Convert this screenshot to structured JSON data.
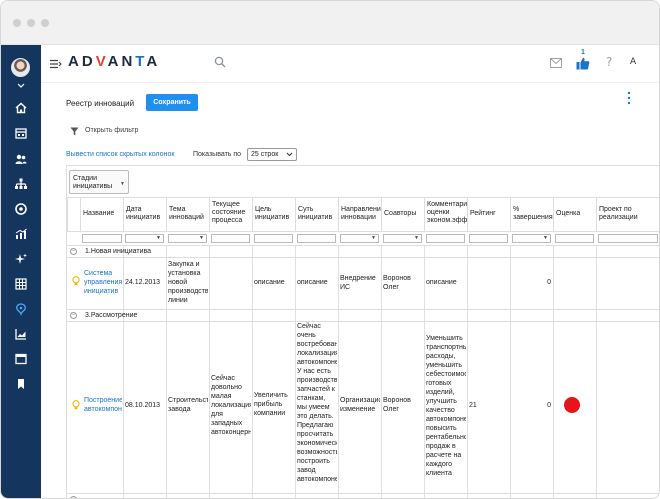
{
  "app": {
    "logo_text": "ADVANTA",
    "like_count": "1",
    "help_glyph": "?",
    "lang_glyph": "A",
    "colors": {
      "sidebar": "#14365e",
      "accent": "#1f8ff0",
      "link": "#1a73c8",
      "danger": "#e8141a"
    }
  },
  "toolbar": {
    "page_title": "Реестр инноваций",
    "save_label": "Сохранить",
    "filter_label": "Открыть фильтр",
    "hidden_columns_link": "Вывести список скрытых колонок",
    "show_by_label": "Показывать по",
    "show_by_value": "25 строк"
  },
  "grid": {
    "groupby_label": "Стадии инициативы",
    "columns": [
      {
        "key": "name",
        "label": "Название"
      },
      {
        "key": "date",
        "label": "Дата инициатив"
      },
      {
        "key": "topic",
        "label": "Тема инноваций"
      },
      {
        "key": "state",
        "label": "Текущее состояние процесса"
      },
      {
        "key": "goal",
        "label": "Цель инициатив"
      },
      {
        "key": "essence",
        "label": "Суть инициатив"
      },
      {
        "key": "direction",
        "label": "Направлени инновации"
      },
      {
        "key": "coauthors",
        "label": "Соавторы"
      },
      {
        "key": "comment",
        "label": "Комментарий оценки эконом.эфф"
      },
      {
        "key": "rating",
        "label": "Рейтинг"
      },
      {
        "key": "completion",
        "label": "% завершения"
      },
      {
        "key": "score",
        "label": "Оценка"
      },
      {
        "key": "project",
        "label": "Проект по реализации"
      }
    ],
    "groups": [
      {
        "label": "1.Новая инициатива",
        "rows": [
          {
            "name": "Система управления инициатив",
            "date": "24.12.2013",
            "topic": "Закупка и установка новой производственной линии",
            "state": "",
            "goal": "описание",
            "essence": "описание",
            "direction": "Внедрение ИС",
            "coauthors": "Воронов Олег",
            "comment": "описание",
            "rating": "",
            "completion": "0",
            "score": "",
            "project": ""
          }
        ]
      },
      {
        "label": "3.Рассмотрение",
        "rows": [
          {
            "name": "Построение автокомпонентов",
            "date": "08.10.2013",
            "topic": "Строительство завода",
            "state": "Сейчас довольно малая локализация для западных автоконцернов",
            "goal": "Увеличить прибыль компании",
            "essence": "Сейчас очень востребована локализация автокомпонентов. У нас есть производство запчастей к станкам, мы умеем это делать. Предлагаю просчитать экономическую возможность построить завод автокомпонентов",
            "direction": "Организационное изменение",
            "coauthors": "Воронов Олег",
            "comment": "Уменьшить транспортные расходы, уменьшить себестоимость готовых изделий, улучшить качество автокомпонентов, повысить рентабельность продаж в расчете на каждого клиента",
            "rating": "21",
            "completion": "0",
            "score": "red",
            "project": ""
          }
        ]
      }
    ]
  }
}
